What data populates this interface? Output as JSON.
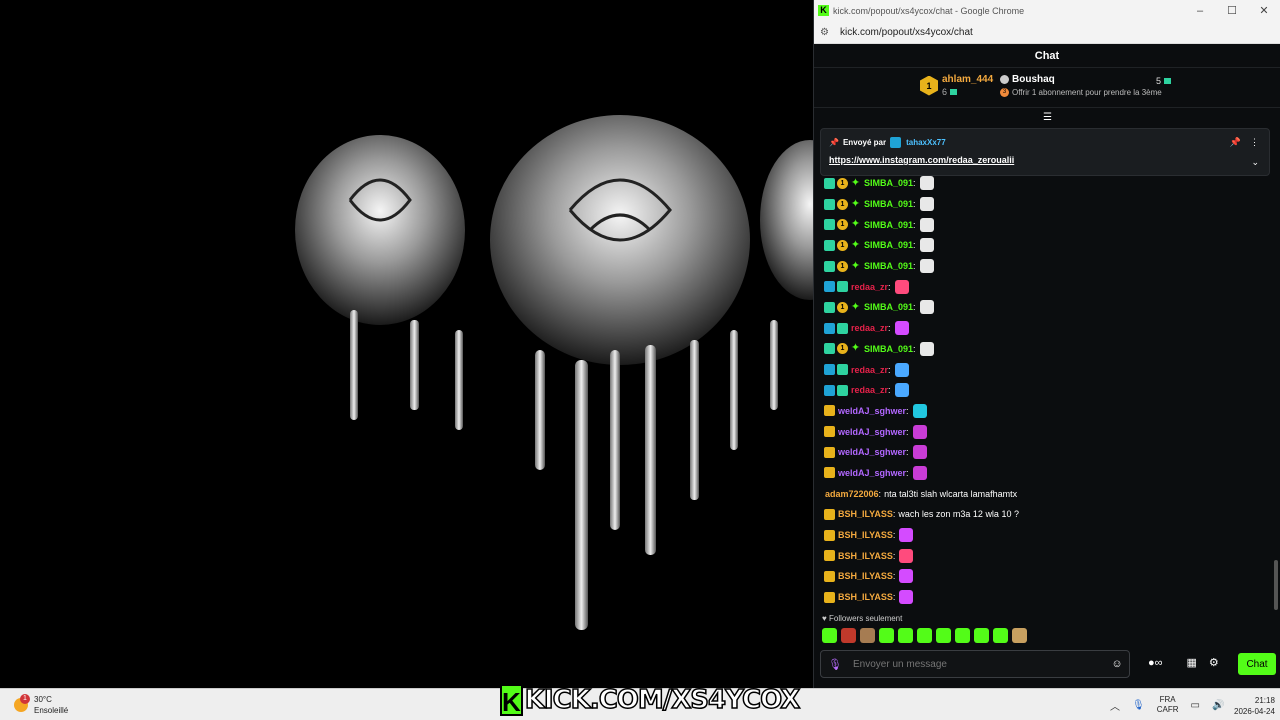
{
  "window": {
    "title": "kick.com/popout/xs4ycox/chat - Google Chrome",
    "url": "kick.com/popout/xs4ycox/chat",
    "favicon_letter": "K",
    "controls": [
      "–",
      "☐",
      "✕"
    ]
  },
  "chat": {
    "header": "Chat",
    "leaderboard": {
      "first": {
        "rank": "1",
        "name": "ahlam_444",
        "count": "6"
      },
      "second": {
        "name": "Boushaq",
        "offer": "Offrir 1 abonnement pour prendre la 3ème",
        "offer_badge": "3",
        "count": "5"
      }
    },
    "pinned": {
      "label": "Envoyé par",
      "sender": "tahaxXx77",
      "link": "https://www.instagram.com/redaa_zeroualii"
    },
    "messages": [
      {
        "badges": [
          "sub",
          "gift",
          "star"
        ],
        "gift_num": "1",
        "user": "SIMBA_091",
        "color": "#53fc18",
        "text": "",
        "emote": "#e8e8e8"
      },
      {
        "badges": [
          "sub",
          "gift",
          "star"
        ],
        "gift_num": "1",
        "user": "SIMBA_091",
        "color": "#53fc18",
        "text": "",
        "emote": "#e8e8e8"
      },
      {
        "badges": [
          "sub",
          "gift",
          "star"
        ],
        "gift_num": "1",
        "user": "SIMBA_091",
        "color": "#53fc18",
        "text": "",
        "emote": "#e8e8e8"
      },
      {
        "badges": [
          "sub",
          "gift",
          "star"
        ],
        "gift_num": "1",
        "user": "SIMBA_091",
        "color": "#53fc18",
        "text": "",
        "emote": "#e8e8e8"
      },
      {
        "badges": [
          "sub",
          "gift",
          "star"
        ],
        "gift_num": "1",
        "user": "SIMBA_091",
        "color": "#53fc18",
        "text": "",
        "emote": "#e8e8e8"
      },
      {
        "badges": [
          "og",
          "sub"
        ],
        "user": "redaa_zr",
        "color": "#e5224a",
        "text": "",
        "emote": "#ff4b7d"
      },
      {
        "badges": [
          "sub",
          "gift",
          "star"
        ],
        "gift_num": "1",
        "user": "SIMBA_091",
        "color": "#53fc18",
        "text": "",
        "emote": "#e8e8e8"
      },
      {
        "badges": [
          "og",
          "sub"
        ],
        "user": "redaa_zr",
        "color": "#e5224a",
        "text": "",
        "emote": "#d44bff"
      },
      {
        "badges": [
          "sub",
          "gift",
          "star"
        ],
        "gift_num": "1",
        "user": "SIMBA_091",
        "color": "#53fc18",
        "text": "",
        "emote": "#e8e8e8"
      },
      {
        "badges": [
          "og",
          "sub"
        ],
        "user": "redaa_zr",
        "color": "#e5224a",
        "text": "",
        "emote": "#4aa8ff"
      },
      {
        "badges": [
          "og",
          "sub"
        ],
        "user": "redaa_zr",
        "color": "#e5224a",
        "text": "",
        "emote": "#4aa8ff"
      },
      {
        "badges": [
          "crown"
        ],
        "user": "weldAJ_sghwer",
        "color": "#b267ff",
        "text": "",
        "emote": "#21c7e0"
      },
      {
        "badges": [
          "crown"
        ],
        "user": "weldAJ_sghwer",
        "color": "#b267ff",
        "text": "",
        "emote": "#c93cd6"
      },
      {
        "badges": [
          "crown"
        ],
        "user": "weldAJ_sghwer",
        "color": "#b267ff",
        "text": "",
        "emote": "#c93cd6"
      },
      {
        "badges": [
          "crown"
        ],
        "user": "weldAJ_sghwer",
        "color": "#b267ff",
        "text": "",
        "emote": "#c93cd6"
      },
      {
        "badges": [],
        "user": "adam722006",
        "color": "#f3a93f",
        "text": "nta tal3ti slah wlcarta lamafhamtx",
        "emote": ""
      },
      {
        "badges": [
          "crown"
        ],
        "user": "BSH_ILYASS",
        "color": "#f3a93f",
        "text": "wach les zon m3a 12 wla 10 ?",
        "emote": ""
      },
      {
        "badges": [
          "crown"
        ],
        "user": "BSH_ILYASS",
        "color": "#f3a93f",
        "text": "",
        "emote": "#d44bff"
      },
      {
        "badges": [
          "crown"
        ],
        "user": "BSH_ILYASS",
        "color": "#f3a93f",
        "text": "",
        "emote": "#ff4b7d"
      },
      {
        "badges": [
          "crown"
        ],
        "user": "BSH_ILYASS",
        "color": "#f3a93f",
        "text": "",
        "emote": "#d44bff"
      },
      {
        "badges": [
          "crown"
        ],
        "user": "BSH_ILYASS",
        "color": "#f3a93f",
        "text": "",
        "emote": "#d44bff"
      }
    ],
    "followers_only": "Followers seulement",
    "emote_bar": [
      "#53fc18",
      "#c0392b",
      "#a67c52",
      "#53fc18",
      "#53fc18",
      "#53fc18",
      "#53fc18",
      "#53fc18",
      "#53fc18",
      "#53fc18",
      "#c8a060"
    ],
    "composer": {
      "placeholder": "Envoyer un message"
    },
    "send_label": "Chat",
    "infinity": "∞"
  },
  "taskbar": {
    "weather_temp": "30°C",
    "weather_desc": "Ensoleillé",
    "weather_notif": "1",
    "kick_letter": "K",
    "kick_domain": "KICK.COM/XS4YCOX",
    "lang_1": "FRA",
    "lang_2": "CAFR",
    "time": "21:18",
    "date": "2026-04-24"
  }
}
